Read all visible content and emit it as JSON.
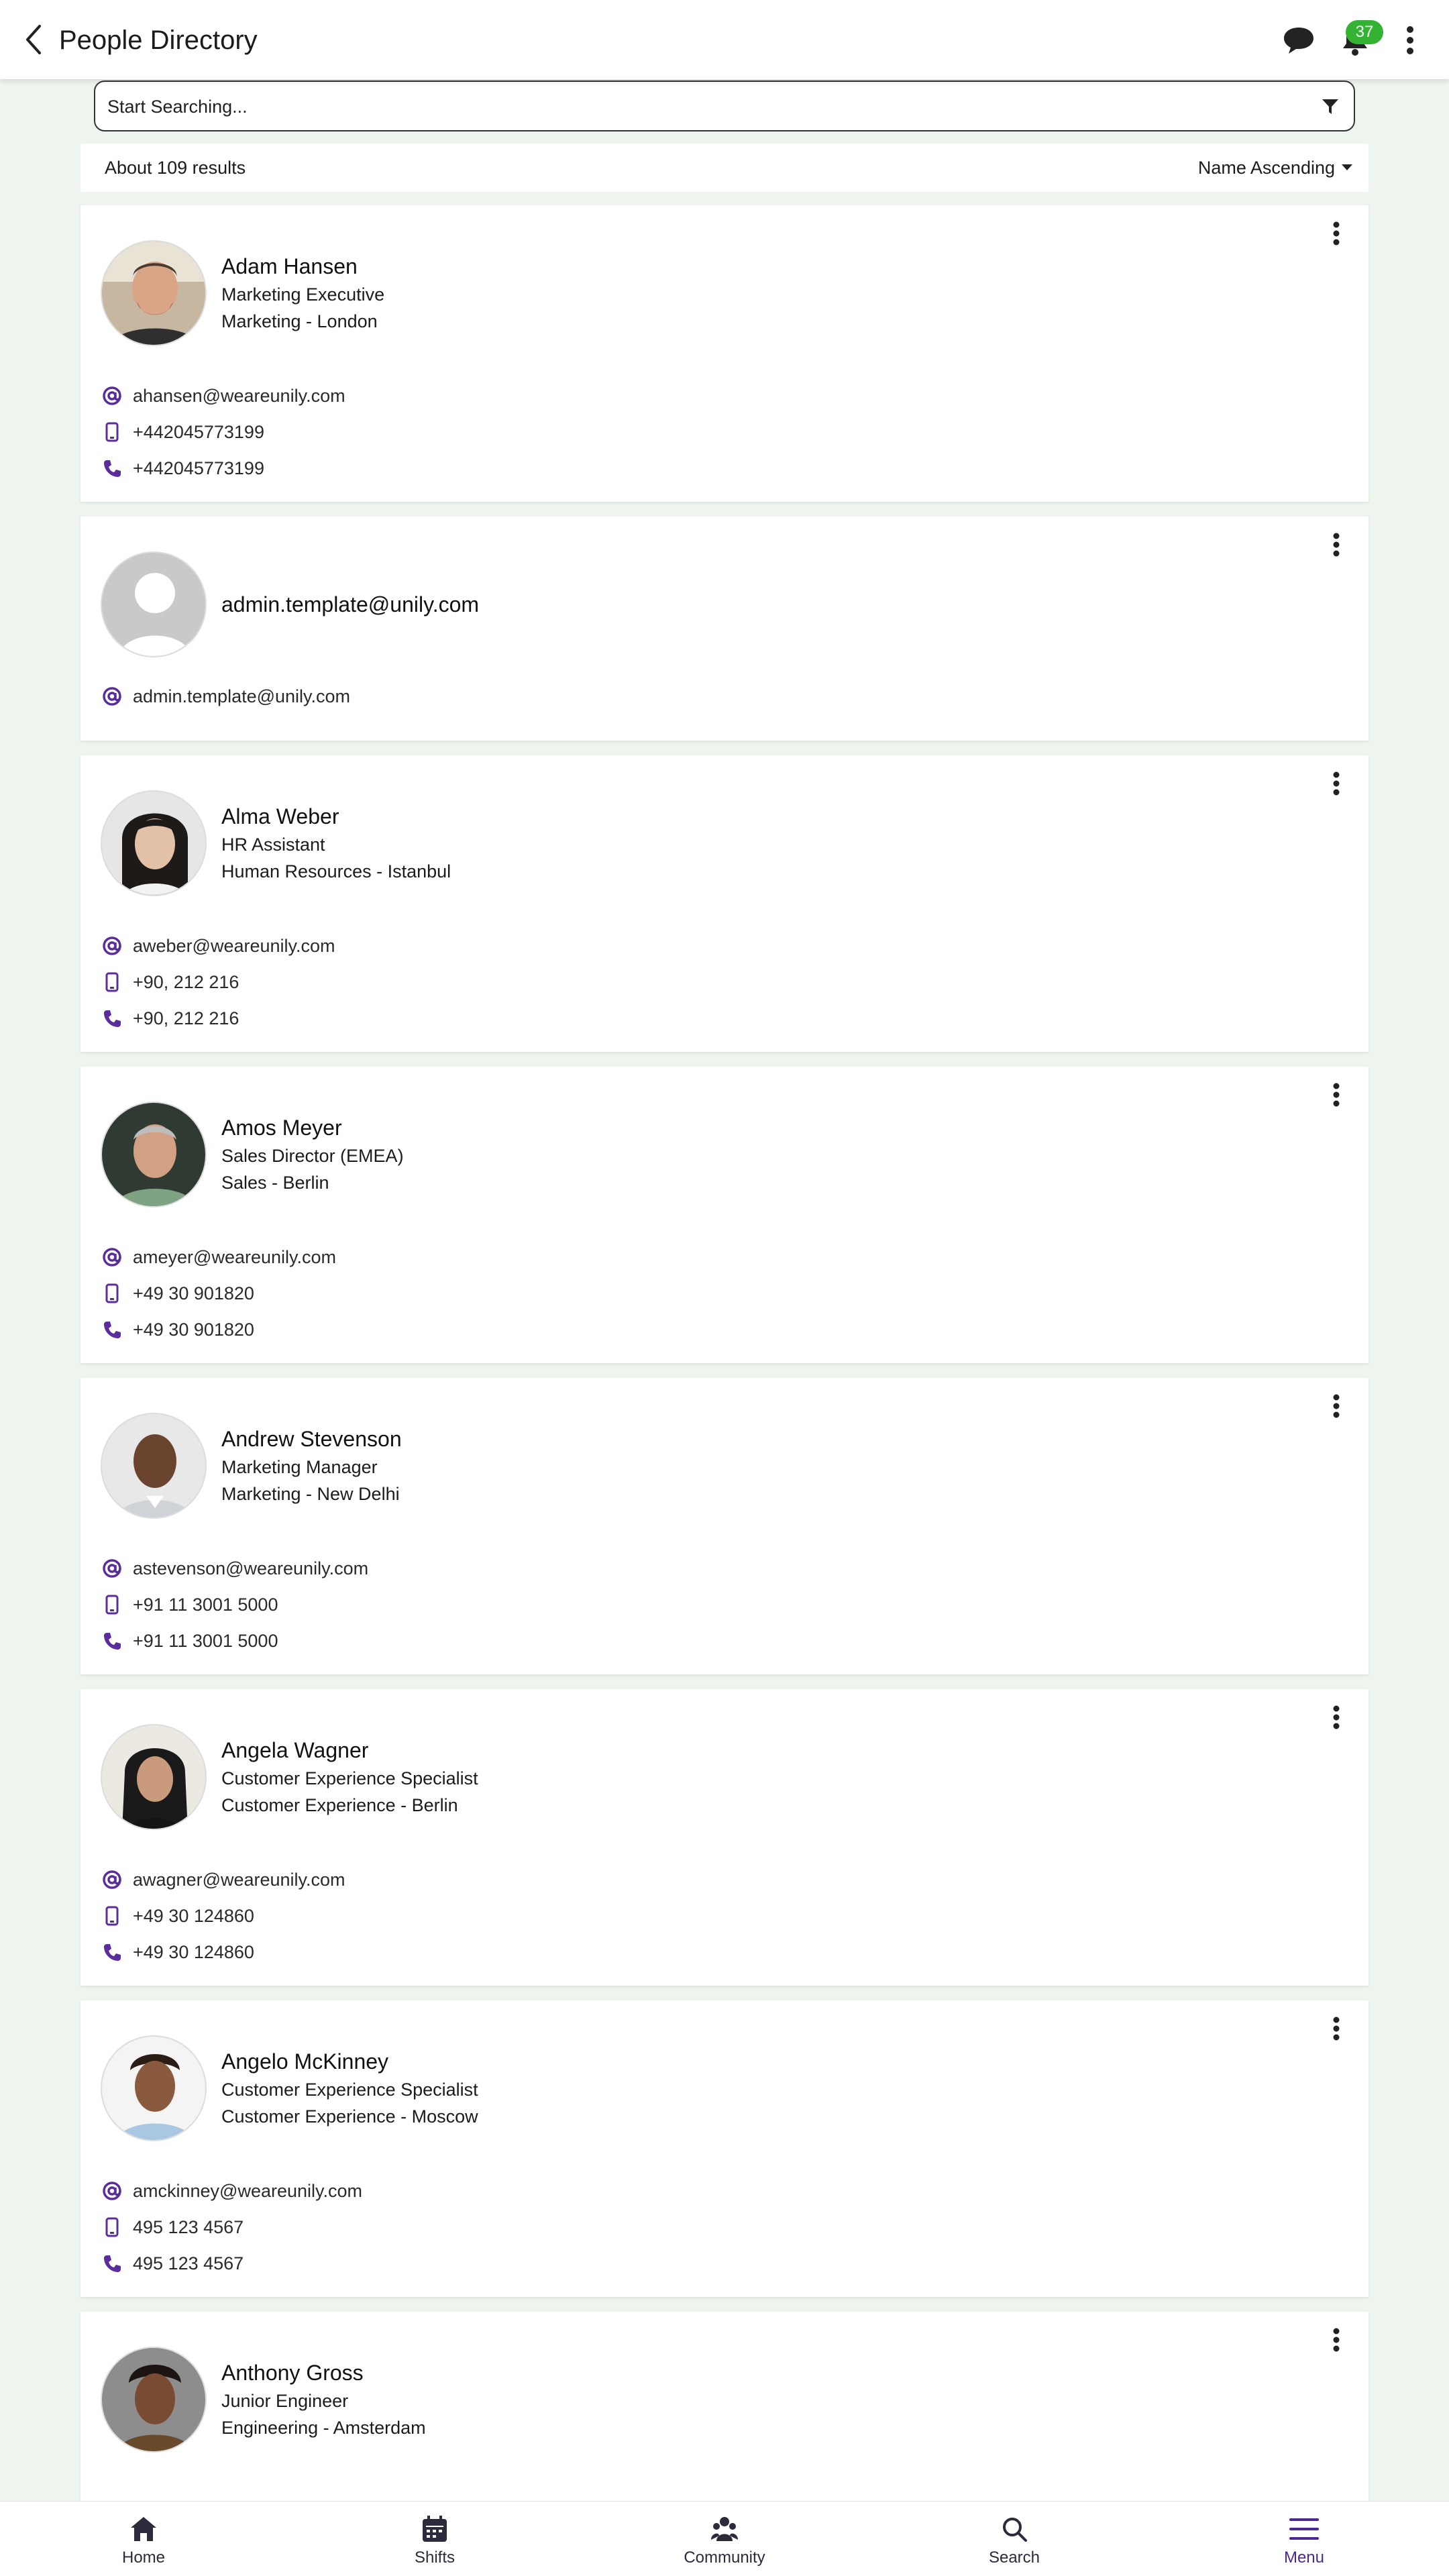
{
  "header": {
    "title": "People Directory",
    "notification_count": "37"
  },
  "search": {
    "placeholder": "Start Searching..."
  },
  "results": {
    "count_text": "About 109 results",
    "sort_label": "Name Ascending"
  },
  "colors": {
    "accent": "#5b2d9c",
    "badge": "#33b233",
    "background": "#eef5ee"
  },
  "people": [
    {
      "name": "Adam Hansen",
      "role": "Marketing Executive",
      "dept": "Marketing - London",
      "email": "ahansen@weareunily.com",
      "mobile": "+442045773199",
      "phone": "+442045773199"
    },
    {
      "name": "admin.template@unily.com",
      "email": "admin.template@unily.com"
    },
    {
      "name": "Alma Weber",
      "role": "HR Assistant",
      "dept": "Human Resources - Istanbul",
      "email": "aweber@weareunily.com",
      "mobile": "+90, 212 216",
      "phone": "+90, 212 216"
    },
    {
      "name": "Amos Meyer",
      "role": "Sales Director (EMEA)",
      "dept": "Sales - Berlin",
      "email": "ameyer@weareunily.com",
      "mobile": "+49 30 901820",
      "phone": "+49 30 901820"
    },
    {
      "name": "Andrew Stevenson",
      "role": "Marketing Manager",
      "dept": "Marketing - New Delhi",
      "email": "astevenson@weareunily.com",
      "mobile": "+91 11 3001 5000",
      "phone": "+91 11 3001 5000"
    },
    {
      "name": "Angela Wagner",
      "role": "Customer Experience Specialist",
      "dept": "Customer Experience - Berlin",
      "email": "awagner@weareunily.com",
      "mobile": "+49 30 124860",
      "phone": "+49 30 124860"
    },
    {
      "name": "Angelo McKinney",
      "role": "Customer Experience Specialist",
      "dept": "Customer Experience - Moscow",
      "email": "amckinney@weareunily.com",
      "mobile": "495 123 4567",
      "phone": "495 123 4567"
    },
    {
      "name": "Anthony Gross",
      "role": "Junior Engineer",
      "dept": "Engineering - Amsterdam"
    }
  ],
  "nav": {
    "home": "Home",
    "shifts": "Shifts",
    "community": "Community",
    "search": "Search",
    "menu": "Menu"
  }
}
